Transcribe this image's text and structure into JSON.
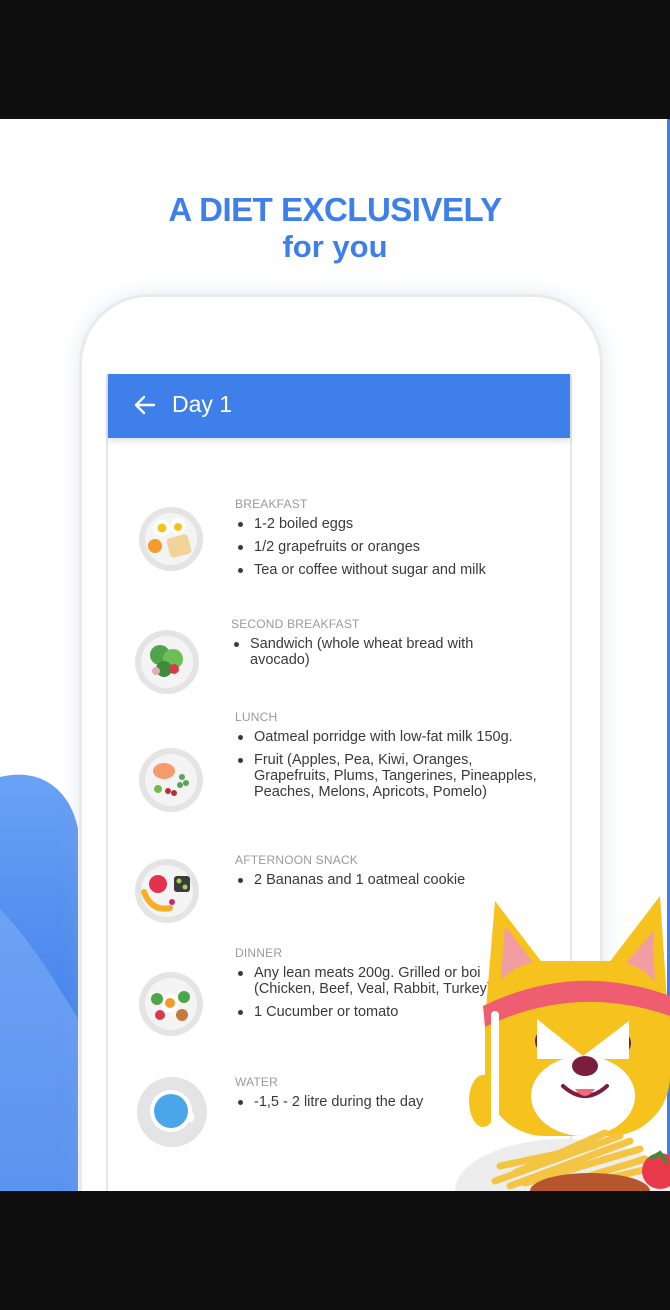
{
  "promo": {
    "headline": "A DIET EXCLUSIVELY",
    "subheadline": "for you"
  },
  "appbar": {
    "title": "Day 1",
    "back_icon": "arrow-left-icon",
    "color": "#3f7fe9"
  },
  "meals": [
    {
      "label": "BREAKFAST",
      "icon": "eggs-toast-plate-icon",
      "items": [
        "1-2 boiled eggs",
        "1/2 grapefruits or oranges",
        "Tea or coffee without sugar and milk"
      ]
    },
    {
      "label": "SECOND BREAKFAST",
      "icon": "salad-plate-icon",
      "items": [
        "Sandwich (whole wheat bread with avocado)"
      ]
    },
    {
      "label": "LUNCH",
      "icon": "lunch-plate-icon",
      "items": [
        "Oatmeal porridge with low-fat milk 150g.",
        "Fruit (Apples, Pea, Kiwi, Oranges, Grapefruits, Plums, Tangerines, Pineapples, Peaches, Melons, Apricots, Pomelo)"
      ]
    },
    {
      "label": "AFTERNOON SNACK",
      "icon": "fruit-snack-plate-icon",
      "items": [
        "2 Bananas and 1 oatmeal cookie"
      ]
    },
    {
      "label": "DINNER",
      "icon": "dinner-plate-icon",
      "items": [
        "Any lean meats 200g. Grilled or boi (Chicken, Beef, Veal, Rabbit, Turkey)",
        "1 Cucumber or tomato"
      ]
    },
    {
      "label": "WATER",
      "icon": "water-glass-icon",
      "items": [
        "-1,5 - 2 litre during the day"
      ]
    }
  ],
  "colors": {
    "accent": "#3f7fe9",
    "text": "#3a3a3a",
    "label": "#9a9a9a"
  }
}
